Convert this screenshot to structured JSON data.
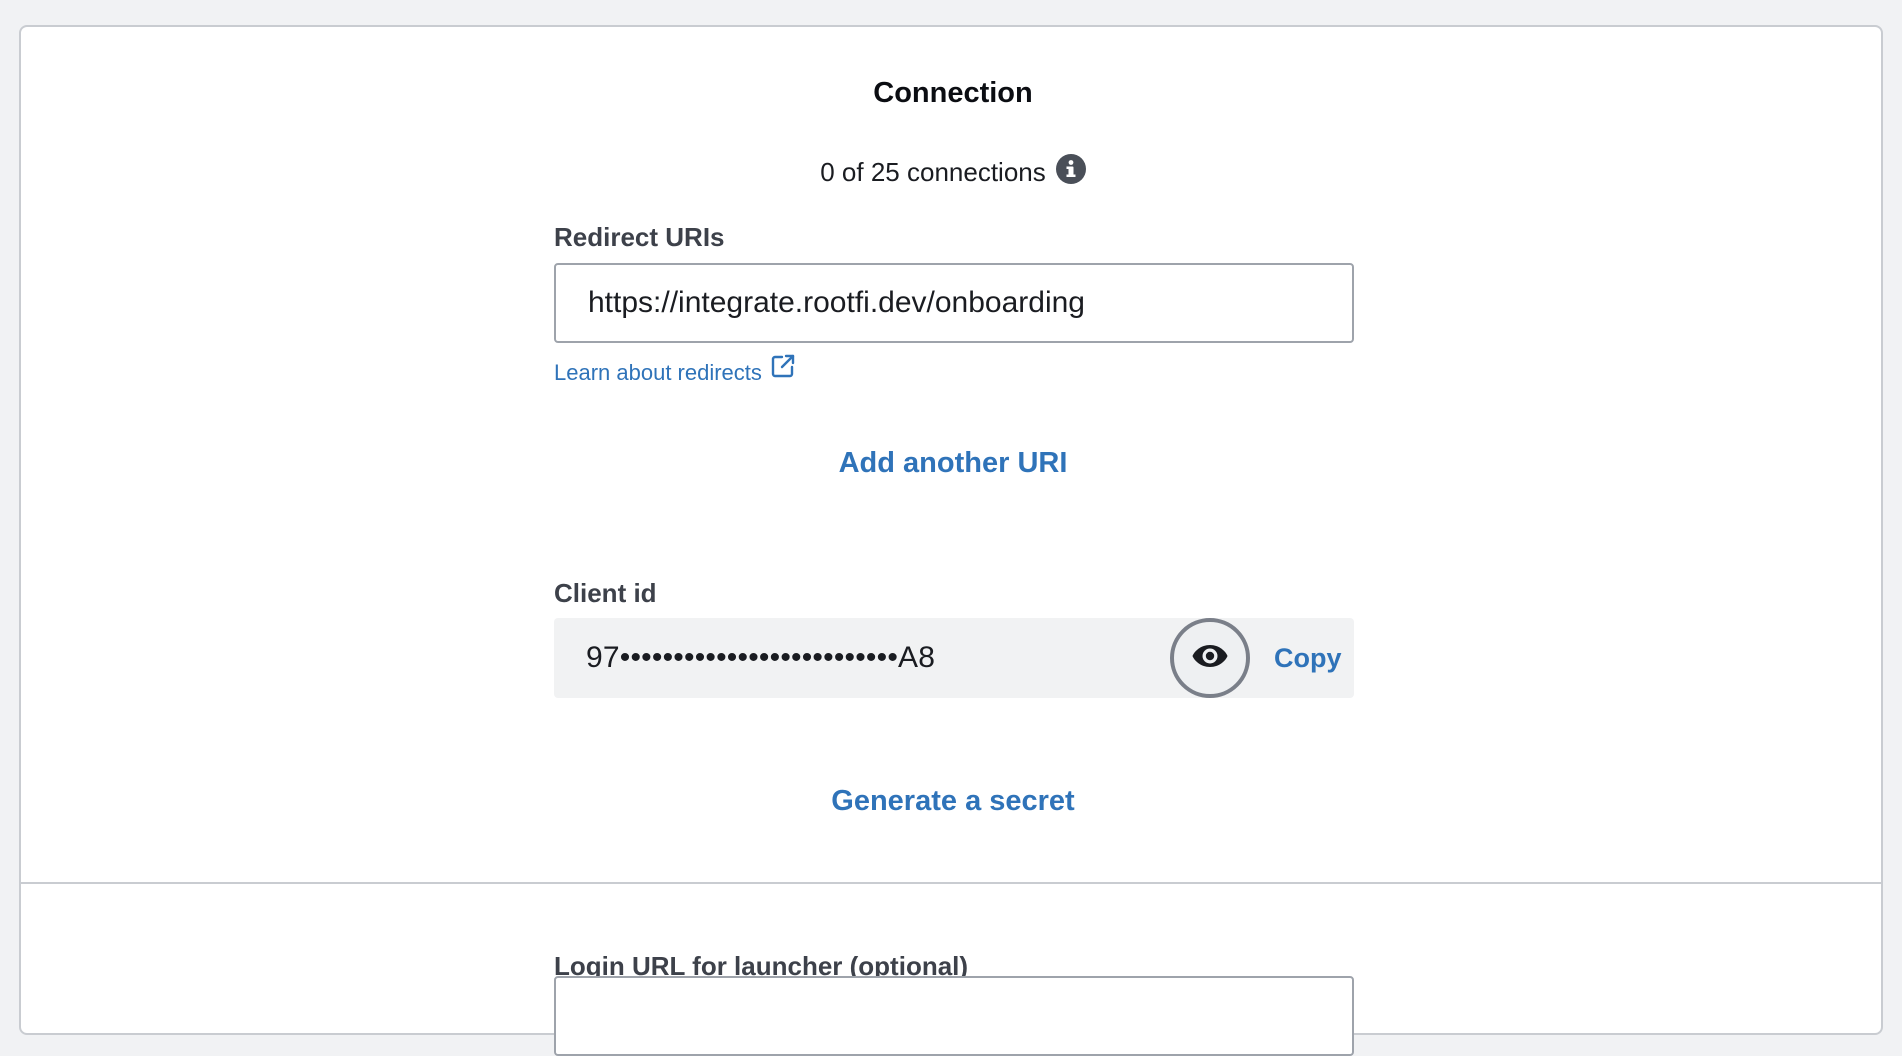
{
  "connection": {
    "title": "Connection",
    "count_text": "0 of 25 connections"
  },
  "redirect": {
    "label": "Redirect URIs",
    "value": "https://integrate.rootfi.dev/onboarding",
    "learn_link": "Learn about redirects",
    "add_another": "Add another URI"
  },
  "client": {
    "label": "Client id",
    "masked_value": "97••••••••••••••••••••••••••A8",
    "copy_label": "Copy"
  },
  "generate_secret": "Generate a secret",
  "launcher": {
    "label": "Login URL for launcher (optional)",
    "value": ""
  },
  "colors": {
    "accent": "#2f73b9",
    "background": "#f1f2f4"
  },
  "icons": {
    "info": "info-icon",
    "external_link": "external-link-icon",
    "eye": "eye-icon"
  }
}
